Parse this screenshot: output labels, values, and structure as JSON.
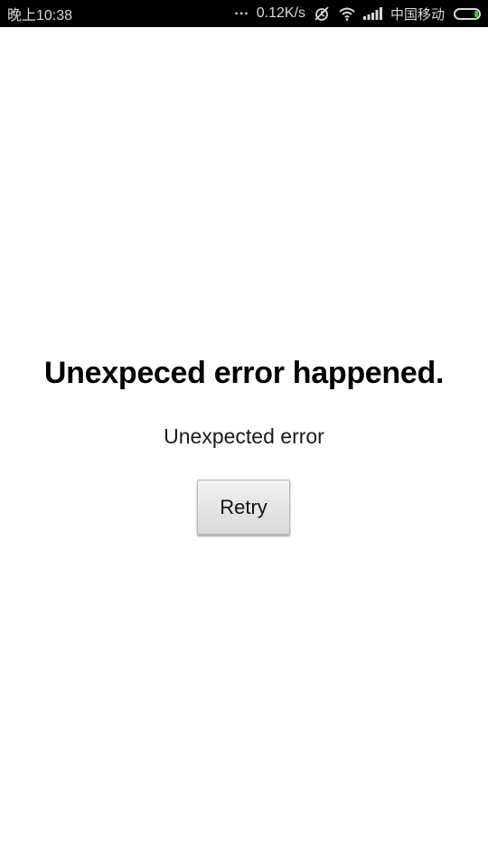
{
  "status_bar": {
    "time": "晚上10:38",
    "overflow_dots": "...",
    "network_speed": "0.12K/s",
    "carrier": "中国移动",
    "battery_fill_fraction": 0.15,
    "battery_color": "#45c92e",
    "icons": [
      "alarm-off-icon",
      "wifi-icon",
      "signal-icon",
      "battery-icon"
    ]
  },
  "error": {
    "title": "Unexpeced error happened.",
    "message": "Unexpected error"
  },
  "actions": {
    "retry_label": "Retry"
  }
}
